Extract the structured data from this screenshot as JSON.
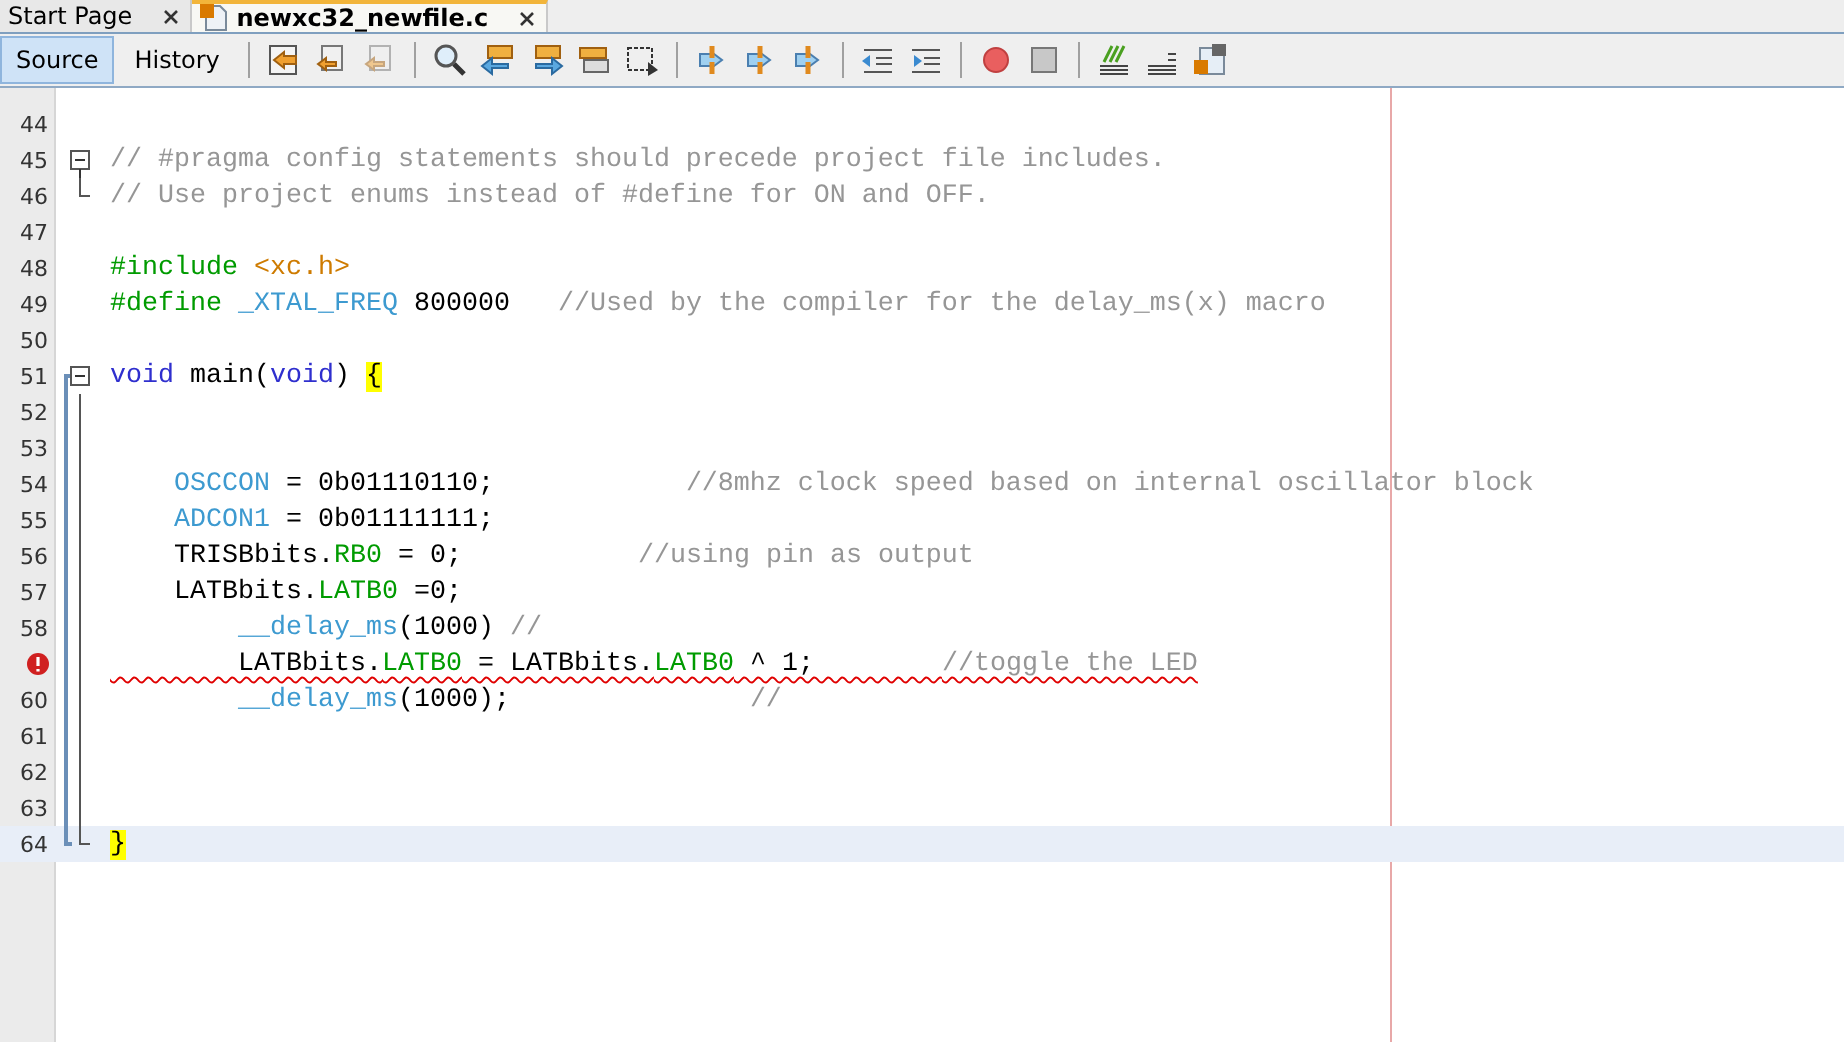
{
  "tabs": [
    {
      "label": "Start Page",
      "selected": false,
      "file_icon": false
    },
    {
      "label": "newxc32_newfile.c",
      "selected": true,
      "file_icon": true
    }
  ],
  "view_tabs": [
    {
      "label": "Source",
      "selected": true
    },
    {
      "label": "History",
      "selected": false
    }
  ],
  "editor": {
    "lines": [
      {
        "number": "44"
      },
      {
        "number": "45",
        "fold_start": true,
        "tokens": [
          {
            "kind": "comment",
            "text": "// #pragma config statements should precede project file includes."
          }
        ]
      },
      {
        "number": "46",
        "fold_end": true,
        "tokens": [
          {
            "kind": "comment",
            "text": "// Use project enums instead of #define for ON and OFF."
          }
        ]
      },
      {
        "number": "47"
      },
      {
        "number": "48",
        "tokens": [
          {
            "kind": "preproc",
            "text": "#include "
          },
          {
            "kind": "string",
            "text": "<xc.h>"
          }
        ]
      },
      {
        "number": "49",
        "tokens": [
          {
            "kind": "preproc",
            "text": "#define "
          },
          {
            "kind": "macro",
            "text": "_XTAL_FREQ"
          },
          {
            "kind": "plain",
            "text": " 800000   "
          },
          {
            "kind": "comment",
            "text": "//Used by the compiler for the delay_ms(x) macro"
          }
        ]
      },
      {
        "number": "50"
      },
      {
        "number": "51",
        "fold_start": true,
        "tokens": [
          {
            "kind": "keyword",
            "text": "void"
          },
          {
            "kind": "plain",
            "text": " main("
          },
          {
            "kind": "keyword",
            "text": "void"
          },
          {
            "kind": "plain",
            "text": ") "
          },
          {
            "kind": "brace",
            "text": "{"
          }
        ]
      },
      {
        "number": "52"
      },
      {
        "number": "53"
      },
      {
        "number": "54",
        "tokens": [
          {
            "kind": "register",
            "text": "    OSCCON"
          },
          {
            "kind": "plain",
            "text": " = 0b01110110;            "
          },
          {
            "kind": "comment",
            "text": "//8mhz clock speed based on internal oscillator block"
          }
        ]
      },
      {
        "number": "55",
        "tokens": [
          {
            "kind": "register",
            "text": "    ADCON1"
          },
          {
            "kind": "plain",
            "text": " = 0b01111111;"
          }
        ]
      },
      {
        "number": "56",
        "tokens": [
          {
            "kind": "plain",
            "text": "    TRISBbits."
          },
          {
            "kind": "field",
            "text": "RB0"
          },
          {
            "kind": "plain",
            "text": " = 0;           "
          },
          {
            "kind": "comment",
            "text": "//using pin as output"
          }
        ]
      },
      {
        "number": "57",
        "tokens": [
          {
            "kind": "plain",
            "text": "    LATBbits."
          },
          {
            "kind": "field",
            "text": "LATB0"
          },
          {
            "kind": "plain",
            "text": " =0;"
          }
        ]
      },
      {
        "number": "58",
        "tokens": [
          {
            "kind": "macro",
            "text": "        __delay_ms"
          },
          {
            "kind": "plain",
            "text": "(1000) "
          },
          {
            "kind": "comment",
            "text": "//"
          }
        ]
      },
      {
        "error": true,
        "tokens": [
          {
            "kind": "plain",
            "text": "        LATBbits."
          },
          {
            "kind": "field",
            "text": "LATB0"
          },
          {
            "kind": "plain",
            "text": " = LATBbits."
          },
          {
            "kind": "field",
            "text": "LATB0"
          },
          {
            "kind": "plain",
            "text": " ^ 1;        "
          },
          {
            "kind": "comment",
            "text": "//toggle the LED"
          }
        ]
      },
      {
        "number": "60",
        "tokens": [
          {
            "kind": "macro",
            "text": "        __delay_ms"
          },
          {
            "kind": "plain",
            "text": "(1000);               "
          },
          {
            "kind": "comment",
            "text": "//"
          }
        ]
      },
      {
        "number": "61"
      },
      {
        "number": "62"
      },
      {
        "number": "63"
      },
      {
        "number": "64",
        "fold_end": true,
        "current": true,
        "tokens": [
          {
            "kind": "brace",
            "text": "}"
          }
        ]
      }
    ]
  }
}
